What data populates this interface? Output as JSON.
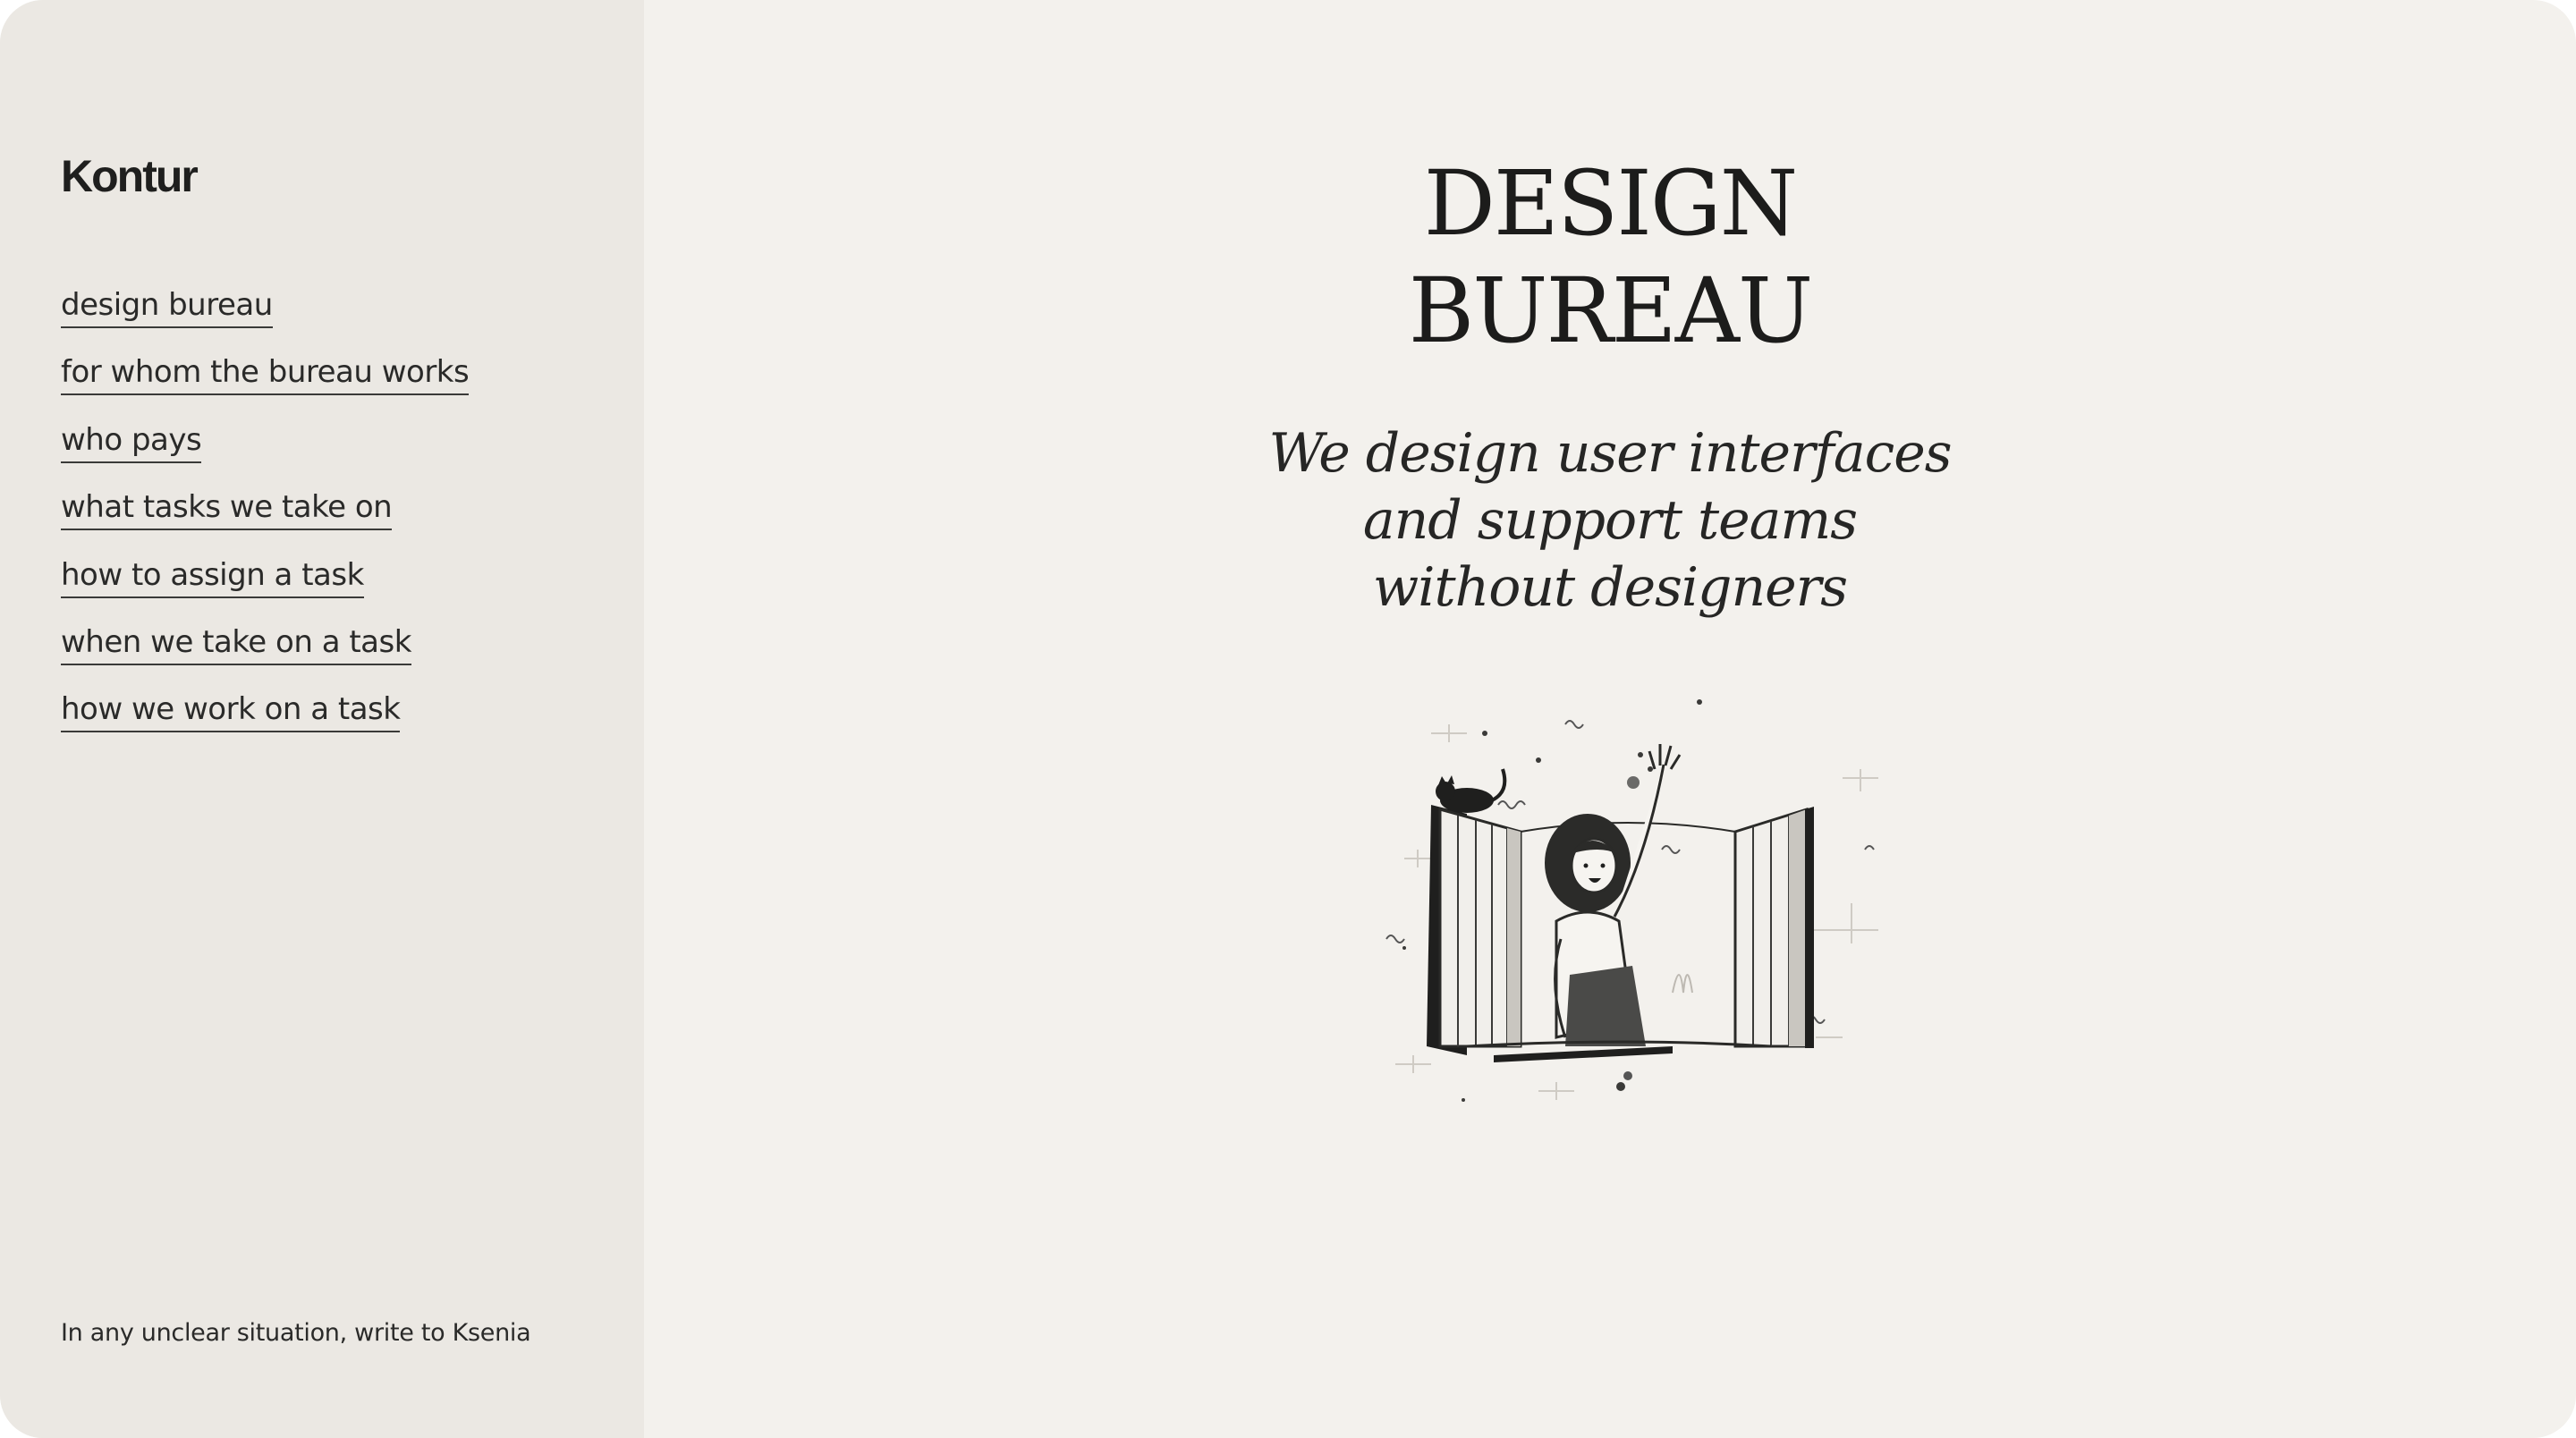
{
  "brand": {
    "logo_text": "Kontur"
  },
  "sidebar": {
    "nav_items": [
      {
        "label": "design bureau"
      },
      {
        "label": "for whom the bureau works"
      },
      {
        "label": "who pays"
      },
      {
        "label": "what tasks we take on"
      },
      {
        "label": "how to assign a task"
      },
      {
        "label": "when we take on a task"
      },
      {
        "label": "how we work on a task"
      }
    ],
    "contact_text": "In any unclear situation, write to Ksenia"
  },
  "hero": {
    "title_line1": "DESIGN",
    "title_line2": "BUREAU",
    "subtitle_lines": [
      "We design user interfaces",
      "and support teams",
      "without designers"
    ]
  },
  "colors": {
    "page_background": "#f3f1ed",
    "sidebar_background": "#ebe8e3",
    "text": "#222220"
  },
  "illustration": {
    "icon": "woman-waving-from-window-with-cat"
  }
}
